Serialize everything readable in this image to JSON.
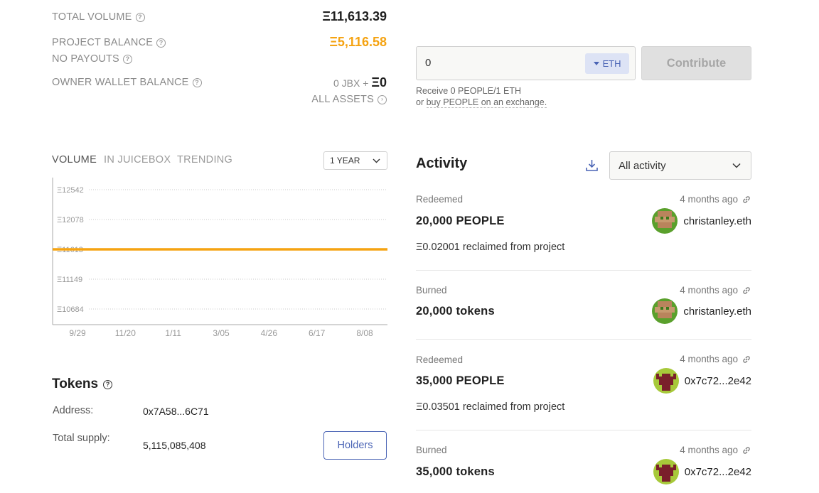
{
  "stats": {
    "total_volume_label": "TOTAL VOLUME",
    "total_volume_value": "Ξ11,613.39",
    "project_balance_label": "PROJECT BALANCE",
    "project_balance_value": "Ξ5,116.58",
    "no_payouts_label": "NO PAYOUTS",
    "owner_wallet_label": "OWNER WALLET BALANCE",
    "owner_wallet_jbx": "0 JBX +",
    "owner_wallet_eth": "Ξ0",
    "all_assets_label": "ALL ASSETS"
  },
  "contribute": {
    "amount_value": "0",
    "currency": "ETH",
    "button_label": "Contribute",
    "receive_text": "Receive 0 PEOPLE/1 ETH",
    "exchange_prefix": "or",
    "exchange_link": "buy PEOPLE on an exchange."
  },
  "chart_tabs": {
    "volume": "VOLUME",
    "in_juicebox": "IN JUICEBOX",
    "trending": "TRENDING",
    "range": "1 YEAR"
  },
  "chart_data": {
    "type": "line",
    "x_ticks": [
      "9/29",
      "11/20",
      "1/11",
      "3/05",
      "4/26",
      "6/17",
      "8/08"
    ],
    "y_ticks": [
      "Ξ12542",
      "Ξ12078",
      "Ξ11613",
      "Ξ11149",
      "Ξ10684"
    ],
    "ylim": [
      10684,
      12542
    ],
    "series": [
      {
        "values": [
          11613,
          11613,
          11613,
          11613,
          11613,
          11613,
          11613
        ]
      }
    ],
    "line_color": "#f5a312",
    "grid": "dotted-horizontal"
  },
  "tokens": {
    "title": "Tokens",
    "address_label": "Address:",
    "address_value": "0x7A58...6C71",
    "supply_label": "Total supply:",
    "supply_value": "5,115,085,408",
    "holders_button": "Holders"
  },
  "activity": {
    "title": "Activity",
    "filter_value": "All activity",
    "items": [
      {
        "type": "Redeemed",
        "time": "4 months ago",
        "amount": "20,000 PEOPLE",
        "user": "christanley.eth",
        "note": "Ξ0.02001 reclaimed from project"
      },
      {
        "type": "Burned",
        "time": "4 months ago",
        "amount": "20,000 tokens",
        "user": "christanley.eth",
        "note": ""
      },
      {
        "type": "Redeemed",
        "time": "4 months ago",
        "amount": "35,000 PEOPLE",
        "user": "0x7c72...2e42",
        "note": "Ξ0.03501 reclaimed from project"
      },
      {
        "type": "Burned",
        "time": "4 months ago",
        "amount": "35,000 tokens",
        "user": "0x7c72...2e42",
        "note": ""
      }
    ]
  },
  "colors": {
    "accent_orange": "#f5a312",
    "link_blue": "#4a64b5"
  }
}
